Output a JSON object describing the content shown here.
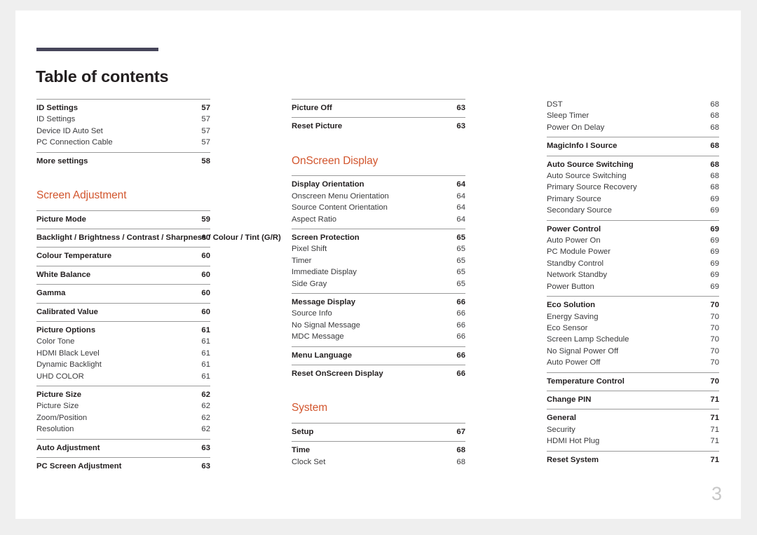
{
  "document": {
    "title": "Table of contents",
    "folio": "3",
    "accent_color": "#d2562e",
    "rule_color": "#46455a"
  },
  "columns": [
    {
      "name": "column-left",
      "blocks": [
        {
          "type": "group",
          "rows": [
            {
              "label": "ID Settings",
              "page": "57",
              "level": "major"
            },
            {
              "label": "ID Settings",
              "page": "57",
              "level": "sub"
            },
            {
              "label": "Device ID Auto Set",
              "page": "57",
              "level": "sub"
            },
            {
              "label": "PC Connection Cable",
              "page": "57",
              "level": "sub"
            }
          ]
        },
        {
          "type": "group",
          "rows": [
            {
              "label": "More settings",
              "page": "58",
              "level": "major"
            }
          ]
        },
        {
          "type": "heading",
          "label": "Screen Adjustment"
        },
        {
          "type": "group",
          "rows": [
            {
              "label": "Picture Mode",
              "page": "59",
              "level": "major"
            }
          ]
        },
        {
          "type": "group",
          "rows": [
            {
              "label": "Backlight / Brightness / Contrast / Sharpness / Colour / Tint (G/R)",
              "page": "60",
              "level": "major-twoline"
            }
          ]
        },
        {
          "type": "group",
          "rows": [
            {
              "label": "Colour Temperature",
              "page": "60",
              "level": "major"
            }
          ]
        },
        {
          "type": "group",
          "rows": [
            {
              "label": "White Balance",
              "page": "60",
              "level": "major"
            }
          ]
        },
        {
          "type": "group",
          "rows": [
            {
              "label": "Gamma",
              "page": "60",
              "level": "major"
            }
          ]
        },
        {
          "type": "group",
          "rows": [
            {
              "label": "Calibrated Value",
              "page": "60",
              "level": "major"
            }
          ]
        },
        {
          "type": "group",
          "rows": [
            {
              "label": "Picture Options",
              "page": "61",
              "level": "major"
            },
            {
              "label": "Color Tone",
              "page": "61",
              "level": "sub"
            },
            {
              "label": "HDMI Black Level",
              "page": "61",
              "level": "sub"
            },
            {
              "label": "Dynamic Backlight",
              "page": "61",
              "level": "sub"
            },
            {
              "label": "UHD COLOR",
              "page": "61",
              "level": "sub"
            }
          ]
        },
        {
          "type": "group",
          "rows": [
            {
              "label": "Picture Size",
              "page": "62",
              "level": "major"
            },
            {
              "label": "Picture Size",
              "page": "62",
              "level": "sub"
            },
            {
              "label": "Zoom/Position",
              "page": "62",
              "level": "sub"
            },
            {
              "label": "Resolution",
              "page": "62",
              "level": "sub"
            }
          ]
        },
        {
          "type": "group",
          "rows": [
            {
              "label": "Auto Adjustment",
              "page": "63",
              "level": "major"
            }
          ]
        },
        {
          "type": "group",
          "rows": [
            {
              "label": "PC Screen Adjustment",
              "page": "63",
              "level": "major"
            }
          ]
        }
      ]
    },
    {
      "name": "column-middle",
      "blocks": [
        {
          "type": "group",
          "rows": [
            {
              "label": "Picture Off",
              "page": "63",
              "level": "major"
            }
          ]
        },
        {
          "type": "group",
          "rows": [
            {
              "label": "Reset Picture",
              "page": "63",
              "level": "major"
            }
          ]
        },
        {
          "type": "heading",
          "label": "OnScreen Display"
        },
        {
          "type": "group",
          "rows": [
            {
              "label": "Display Orientation",
              "page": "64",
              "level": "major"
            },
            {
              "label": "Onscreen Menu Orientation",
              "page": "64",
              "level": "sub"
            },
            {
              "label": "Source Content Orientation",
              "page": "64",
              "level": "sub"
            },
            {
              "label": "Aspect Ratio",
              "page": "64",
              "level": "sub"
            }
          ]
        },
        {
          "type": "group",
          "rows": [
            {
              "label": "Screen Protection",
              "page": "65",
              "level": "major"
            },
            {
              "label": "Pixel Shift",
              "page": "65",
              "level": "sub"
            },
            {
              "label": "Timer",
              "page": "65",
              "level": "sub"
            },
            {
              "label": "Immediate Display",
              "page": "65",
              "level": "sub"
            },
            {
              "label": "Side Gray",
              "page": "65",
              "level": "sub"
            }
          ]
        },
        {
          "type": "group",
          "rows": [
            {
              "label": "Message Display",
              "page": "66",
              "level": "major"
            },
            {
              "label": "Source Info",
              "page": "66",
              "level": "sub"
            },
            {
              "label": "No Signal Message",
              "page": "66",
              "level": "sub"
            },
            {
              "label": "MDC Message",
              "page": "66",
              "level": "sub"
            }
          ]
        },
        {
          "type": "group",
          "rows": [
            {
              "label": "Menu Language",
              "page": "66",
              "level": "major"
            }
          ]
        },
        {
          "type": "group",
          "rows": [
            {
              "label": "Reset OnScreen Display",
              "page": "66",
              "level": "major"
            }
          ]
        },
        {
          "type": "heading",
          "label": "System"
        },
        {
          "type": "group",
          "rows": [
            {
              "label": "Setup",
              "page": "67",
              "level": "major"
            }
          ]
        },
        {
          "type": "group",
          "rows": [
            {
              "label": "Time",
              "page": "68",
              "level": "major"
            },
            {
              "label": "Clock Set",
              "page": "68",
              "level": "sub"
            }
          ]
        }
      ]
    },
    {
      "name": "column-right",
      "blocks": [
        {
          "type": "group-no-rule",
          "rows": [
            {
              "label": "DST",
              "page": "68",
              "level": "sub"
            },
            {
              "label": "Sleep Timer",
              "page": "68",
              "level": "sub"
            },
            {
              "label": "Power On Delay",
              "page": "68",
              "level": "sub"
            }
          ]
        },
        {
          "type": "group",
          "rows": [
            {
              "label": "MagicInfo I Source",
              "page": "68",
              "level": "major"
            }
          ]
        },
        {
          "type": "group",
          "rows": [
            {
              "label": "Auto Source Switching",
              "page": "68",
              "level": "major"
            },
            {
              "label": "Auto Source Switching",
              "page": "68",
              "level": "sub"
            },
            {
              "label": "Primary Source Recovery",
              "page": "68",
              "level": "sub"
            },
            {
              "label": "Primary Source",
              "page": "69",
              "level": "sub"
            },
            {
              "label": "Secondary Source",
              "page": "69",
              "level": "sub"
            }
          ]
        },
        {
          "type": "group",
          "rows": [
            {
              "label": "Power Control",
              "page": "69",
              "level": "major"
            },
            {
              "label": "Auto Power On",
              "page": "69",
              "level": "sub"
            },
            {
              "label": "PC Module Power",
              "page": "69",
              "level": "sub"
            },
            {
              "label": "Standby Control",
              "page": "69",
              "level": "sub"
            },
            {
              "label": "Network Standby",
              "page": "69",
              "level": "sub"
            },
            {
              "label": "Power Button",
              "page": "69",
              "level": "sub"
            }
          ]
        },
        {
          "type": "group",
          "rows": [
            {
              "label": "Eco Solution",
              "page": "70",
              "level": "major"
            },
            {
              "label": "Energy Saving",
              "page": "70",
              "level": "sub"
            },
            {
              "label": "Eco Sensor",
              "page": "70",
              "level": "sub"
            },
            {
              "label": "Screen Lamp Schedule",
              "page": "70",
              "level": "sub"
            },
            {
              "label": "No Signal Power Off",
              "page": "70",
              "level": "sub"
            },
            {
              "label": "Auto Power Off",
              "page": "70",
              "level": "sub"
            }
          ]
        },
        {
          "type": "group",
          "rows": [
            {
              "label": "Temperature Control",
              "page": "70",
              "level": "major"
            }
          ]
        },
        {
          "type": "group",
          "rows": [
            {
              "label": "Change PIN",
              "page": "71",
              "level": "major"
            }
          ]
        },
        {
          "type": "group",
          "rows": [
            {
              "label": "General",
              "page": "71",
              "level": "major"
            },
            {
              "label": "Security",
              "page": "71",
              "level": "sub"
            },
            {
              "label": "HDMI Hot Plug",
              "page": "71",
              "level": "sub"
            }
          ]
        },
        {
          "type": "group",
          "rows": [
            {
              "label": "Reset System",
              "page": "71",
              "level": "major"
            }
          ]
        }
      ]
    }
  ]
}
